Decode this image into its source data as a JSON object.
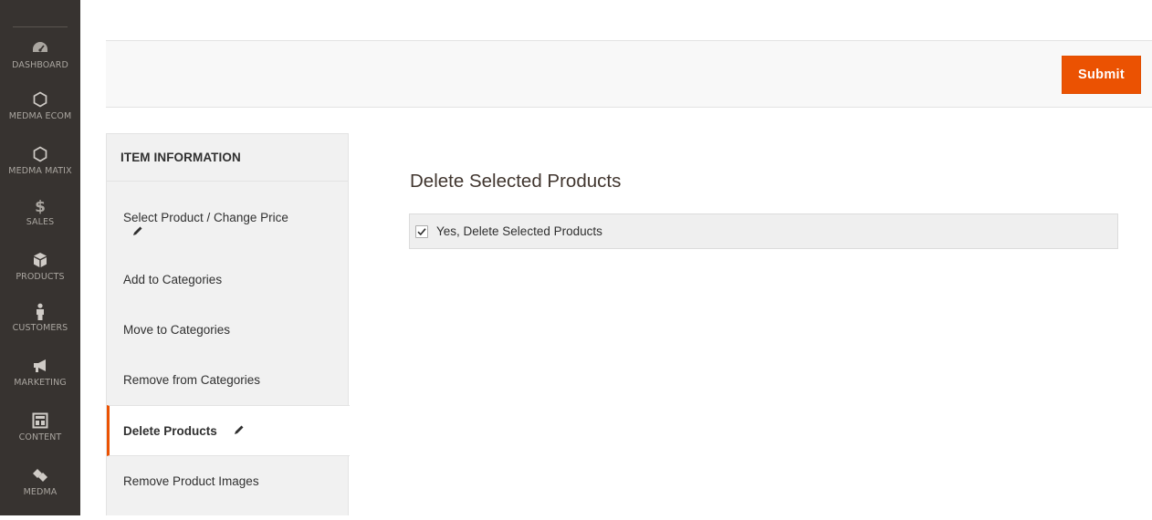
{
  "admin_menu": {
    "items": [
      {
        "label": "DASHBOARD",
        "icon": "dashboard-gauge-icon"
      },
      {
        "label": "MEDMA ECOM",
        "icon": "hexagon-icon"
      },
      {
        "label": "MEDMA MATIX",
        "icon": "hexagon-icon"
      },
      {
        "label": "SALES",
        "icon": "dollar-icon",
        "glyph": "$"
      },
      {
        "label": "PRODUCTS",
        "icon": "cube-icon"
      },
      {
        "label": "CUSTOMERS",
        "icon": "person-icon"
      },
      {
        "label": "MARKETING",
        "icon": "megaphone-icon"
      },
      {
        "label": "CONTENT",
        "icon": "layout-icon"
      },
      {
        "label": "MEDMA",
        "icon": "diamond-icon"
      }
    ]
  },
  "actions": {
    "submit_label": "Submit"
  },
  "tabs": {
    "title": "ITEM INFORMATION",
    "items": [
      {
        "label": "Select Product / Change Price",
        "edit_icon": "pencil-icon"
      },
      {
        "label": "Add to Categories"
      },
      {
        "label": "Move to Categories"
      },
      {
        "label": "Remove from Categories"
      },
      {
        "label": "Delete Products",
        "active": true,
        "edit_icon": "pencil-icon"
      },
      {
        "label": "Remove Product Images"
      }
    ]
  },
  "main": {
    "section_title": "Delete Selected Products",
    "checkbox": {
      "label": "Yes, Delete Selected Products",
      "checked": true
    }
  },
  "colors": {
    "accent": "#eb5202",
    "menu_bg": "#373330",
    "menu_text": "#aaa6a0"
  }
}
